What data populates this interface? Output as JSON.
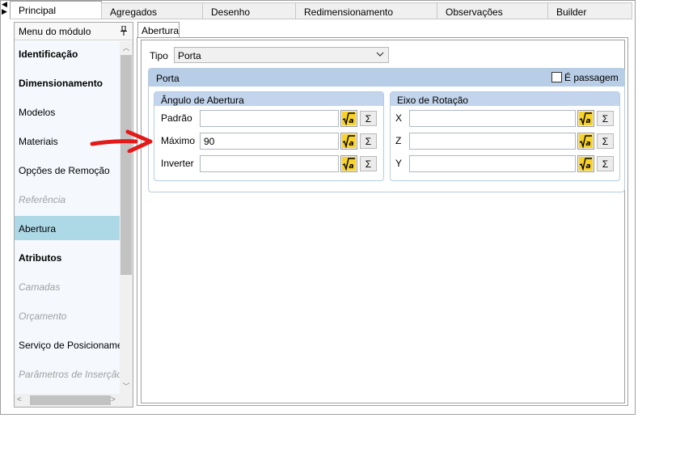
{
  "nav": {
    "left_glyph": "◀",
    "right_glyph": "▶"
  },
  "tabs": [
    {
      "label": "Principal",
      "active": true
    },
    {
      "label": "Agregados"
    },
    {
      "label": "Desenho"
    },
    {
      "label": "Redimensionamento"
    },
    {
      "label": "Observações"
    },
    {
      "label": "Builder"
    }
  ],
  "menu": {
    "header": "Menu do módulo",
    "pin_glyph": "📌",
    "items": [
      {
        "label": "Identificação",
        "style": "bold"
      },
      {
        "label": "Dimensionamento",
        "style": "bold"
      },
      {
        "label": "Modelos",
        "style": "normal"
      },
      {
        "label": "Materiais",
        "style": "normal"
      },
      {
        "label": "Opções de Remoção",
        "style": "normal"
      },
      {
        "label": "Referência",
        "style": "disabled"
      },
      {
        "label": "Abertura",
        "style": "selected"
      },
      {
        "label": "Atributos",
        "style": "bold"
      },
      {
        "label": "Camadas",
        "style": "disabled"
      },
      {
        "label": "Orçamento",
        "style": "disabled"
      },
      {
        "label": "Serviço de Posicionamen",
        "style": "normal"
      },
      {
        "label": "Parâmetros de Inserção",
        "style": "disabled"
      }
    ],
    "scroll_up_glyph": "︿",
    "scroll_down_glyph": "﹀",
    "scroll_left_glyph": "<",
    "scroll_right_glyph": ">"
  },
  "content": {
    "subtab": "Abertura",
    "tipo_label": "Tipo",
    "tipo_value": "Porta",
    "chevron_glyph": "⌄",
    "porta": {
      "title": "Porta",
      "passagem_label": "É passagem",
      "passagem_checked": false,
      "angulo": {
        "title": "Ângulo de Abertura",
        "fields": [
          {
            "label": "Padrão",
            "value": ""
          },
          {
            "label": "Máximo",
            "value": "90"
          },
          {
            "label": "Inverter",
            "value": ""
          }
        ]
      },
      "eixo": {
        "title": "Eixo de Rotação",
        "fields": [
          {
            "label": "X",
            "value": ""
          },
          {
            "label": "Z",
            "value": ""
          },
          {
            "label": "Y",
            "value": ""
          }
        ]
      },
      "sigma_glyph": "Σ"
    }
  },
  "colors": {
    "selected_item": "#add8e6",
    "group_header": "#c3d5ec",
    "porta_header": "#b8cde6",
    "arrow": "#e21a1a"
  }
}
